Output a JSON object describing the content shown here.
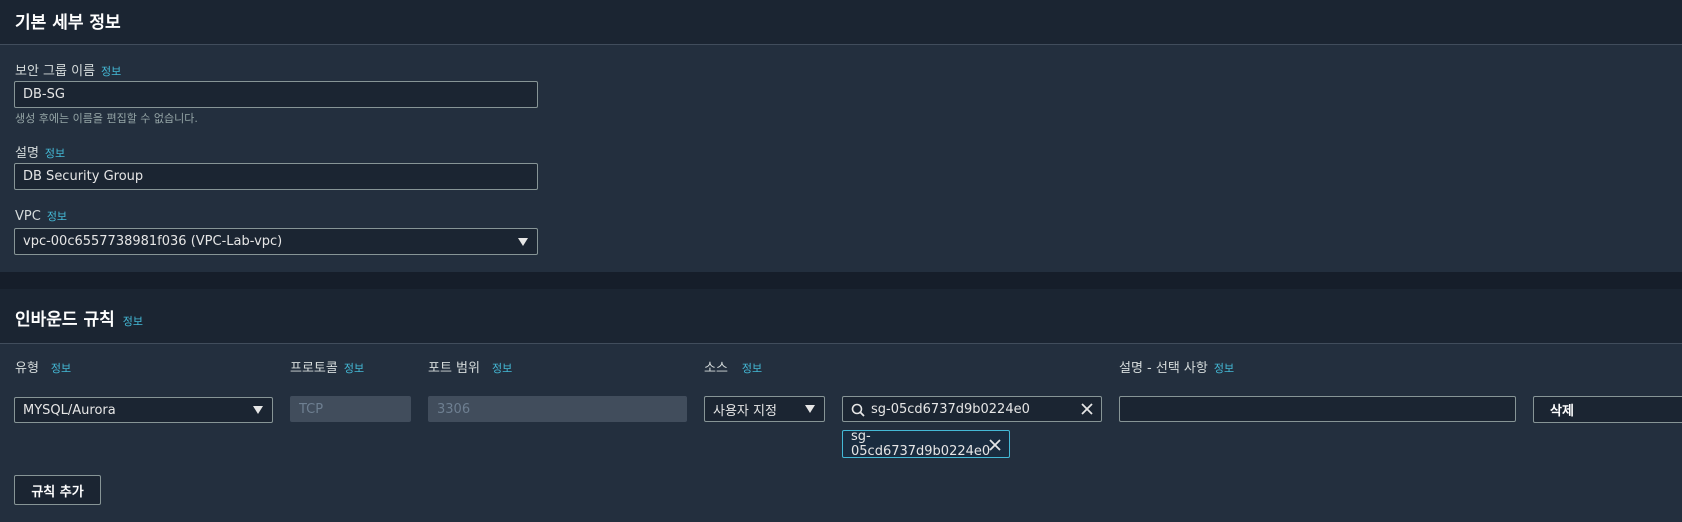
{
  "basic": {
    "title": "기본 세부 정보",
    "sg_name_label": "보안 그룹 이름",
    "sg_name_info": "정보",
    "sg_name_value": "DB-SG",
    "sg_name_hint": "생성 후에는 이름을 편집할 수 없습니다.",
    "desc_label": "설명",
    "desc_info": "정보",
    "desc_value": "DB Security Group",
    "vpc_label": "VPC",
    "vpc_info": "정보",
    "vpc_value": "vpc-00c6557738981f036 (VPC-Lab-vpc)"
  },
  "inbound": {
    "title": "인바운드 규칙",
    "title_info": "정보",
    "columns": [
      {
        "label": "유형",
        "info": "정보"
      },
      {
        "label": "프로토콜",
        "info": "정보"
      },
      {
        "label": "포트 범위",
        "info": "정보"
      },
      {
        "label": "소스",
        "info": "정보"
      },
      {
        "label": "설명 - 선택 사항",
        "info": "정보"
      }
    ],
    "rule": {
      "type": "MYSQL/Aurora",
      "protocol": "TCP",
      "port": "3306",
      "source_type": "사용자 지정",
      "source_search": "sg-05cd6737d9b0224e0",
      "source_token": "sg-05cd6737d9b0224e0",
      "description": "",
      "delete_label": "삭제"
    },
    "add_rule_label": "규칙 추가"
  },
  "icons": {
    "dropdown": "caret-down-icon",
    "search": "search-icon",
    "clear": "close-icon"
  },
  "colors": {
    "info_link": "#44b9d6",
    "token_border": "#44b9d6"
  }
}
